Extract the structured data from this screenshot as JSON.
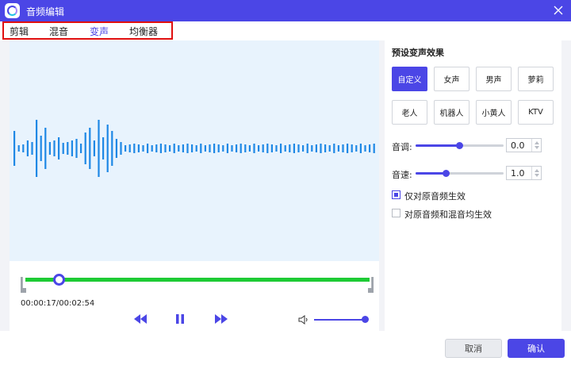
{
  "window": {
    "title": "音频编辑",
    "app_icon": "app-logo-icon",
    "close_icon": "close-icon"
  },
  "tabs": [
    {
      "label": "剪辑",
      "active": false
    },
    {
      "label": "混音",
      "active": false
    },
    {
      "label": "变声",
      "active": true
    },
    {
      "label": "均衡器",
      "active": false
    }
  ],
  "player": {
    "time": "00:00:17/00:02:54",
    "progress": 0.098,
    "volume": 1.0,
    "controls": [
      "rewind-icon",
      "pause-icon",
      "fast-forward-icon",
      "volume-icon"
    ]
  },
  "voice_change": {
    "section_title": "预设变声效果",
    "presets": [
      {
        "label": "自定义",
        "active": true
      },
      {
        "label": "女声",
        "active": false
      },
      {
        "label": "男声",
        "active": false
      },
      {
        "label": "萝莉",
        "active": false
      },
      {
        "label": "老人",
        "active": false
      },
      {
        "label": "机器人",
        "active": false
      },
      {
        "label": "小黄人",
        "active": false
      },
      {
        "label": "KTV",
        "active": false
      }
    ],
    "pitch": {
      "label": "音调:",
      "value": "0.0",
      "level": 0.5
    },
    "speed": {
      "label": "音速:",
      "value": "1.0",
      "level": 0.35
    },
    "apply_options": [
      {
        "label": "仅对原音频生效",
        "checked": true
      },
      {
        "label": "对原音频和混音均生效",
        "checked": false
      }
    ]
  },
  "footer": {
    "cancel_label": "取消",
    "confirm_label": "确认"
  },
  "colors": {
    "accent": "#4b46e6",
    "progress_green": "#1ecb35",
    "wave_blue": "#1e88e5",
    "highlight_red": "#e00f0f"
  }
}
